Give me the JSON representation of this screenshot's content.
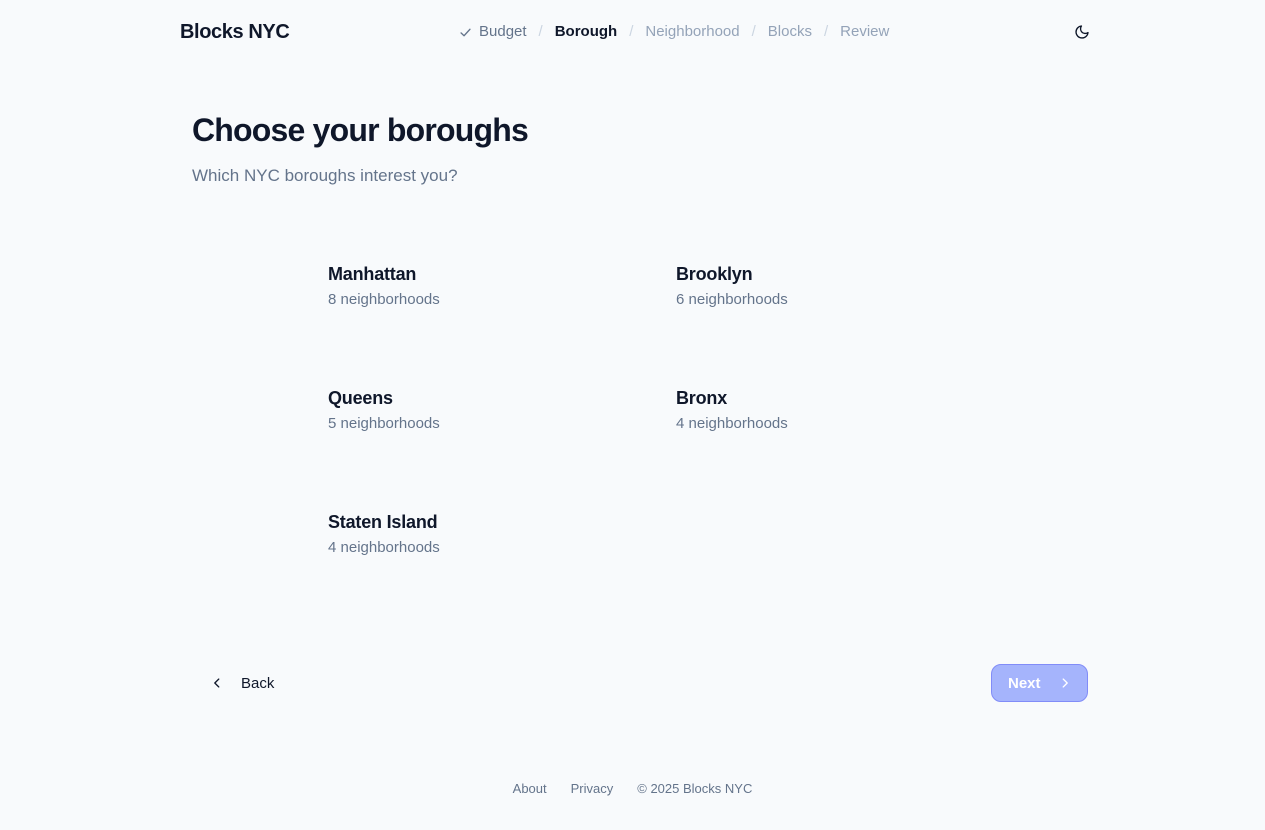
{
  "app": {
    "name": "Blocks NYC"
  },
  "steps": [
    {
      "label": "Budget",
      "state": "done"
    },
    {
      "label": "Borough",
      "state": "current"
    },
    {
      "label": "Neighborhood",
      "state": "future"
    },
    {
      "label": "Blocks",
      "state": "future"
    },
    {
      "label": "Review",
      "state": "future"
    }
  ],
  "step_separator": "/",
  "header": {
    "theme_icon": "moon-icon"
  },
  "main": {
    "title": "Choose your boroughs",
    "subtitle": "Which NYC boroughs interest you?",
    "boroughs": [
      {
        "name": "Manhattan",
        "count": "8 neighborhoods"
      },
      {
        "name": "Brooklyn",
        "count": "6 neighborhoods"
      },
      {
        "name": "Queens",
        "count": "5 neighborhoods"
      },
      {
        "name": "Bronx",
        "count": "4 neighborhoods"
      },
      {
        "name": "Staten Island",
        "count": "4 neighborhoods"
      }
    ]
  },
  "nav": {
    "back_label": "Back",
    "next_label": "Next"
  },
  "footer": {
    "about": "About",
    "privacy": "Privacy",
    "copyright": "© 2025 Blocks NYC"
  },
  "colors": {
    "accent": "#a5b4fc",
    "accent_border": "#818cf8",
    "text_primary": "#0f172a",
    "text_muted": "#64748b",
    "text_disabled": "#94a3b8",
    "background": "#f8fafc"
  }
}
